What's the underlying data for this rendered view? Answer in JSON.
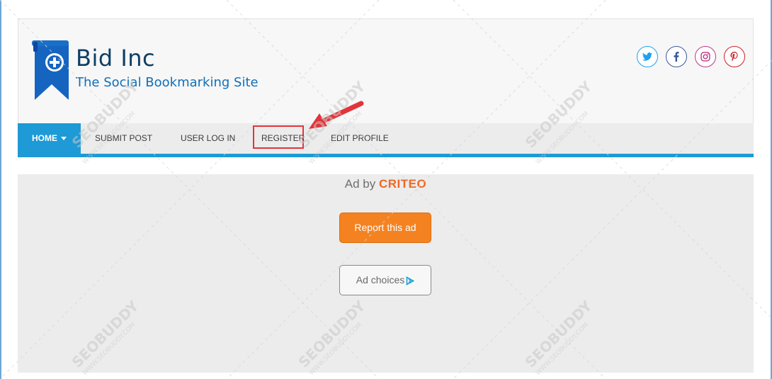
{
  "site": {
    "title": "Bid Inc",
    "tagline": "The Social Bookmarking Site"
  },
  "social": [
    {
      "name": "twitter-icon",
      "color": "#1da1f2"
    },
    {
      "name": "facebook-icon",
      "color": "#3b5998"
    },
    {
      "name": "instagram-icon",
      "color": "#c13584"
    },
    {
      "name": "pinterest-icon",
      "color": "#cb2027"
    }
  ],
  "nav": {
    "home": "HOME",
    "submit_post": "SUBMIT POST",
    "user_login": "USER LOG IN",
    "register": "REGISTER",
    "edit_profile": "EDIT PROFILE",
    "accent_color": "#1e9ad6"
  },
  "ad": {
    "ad_by": "Ad by",
    "brand": "CRITEO",
    "report_label": "Report this ad",
    "choices_label": "Ad choices"
  },
  "annotation": {
    "highlight_color": "#e3343a",
    "target": "register"
  },
  "watermark": {
    "brand": "SEOBUDDY",
    "url": "WWW.SEOBUDDY.COM"
  }
}
